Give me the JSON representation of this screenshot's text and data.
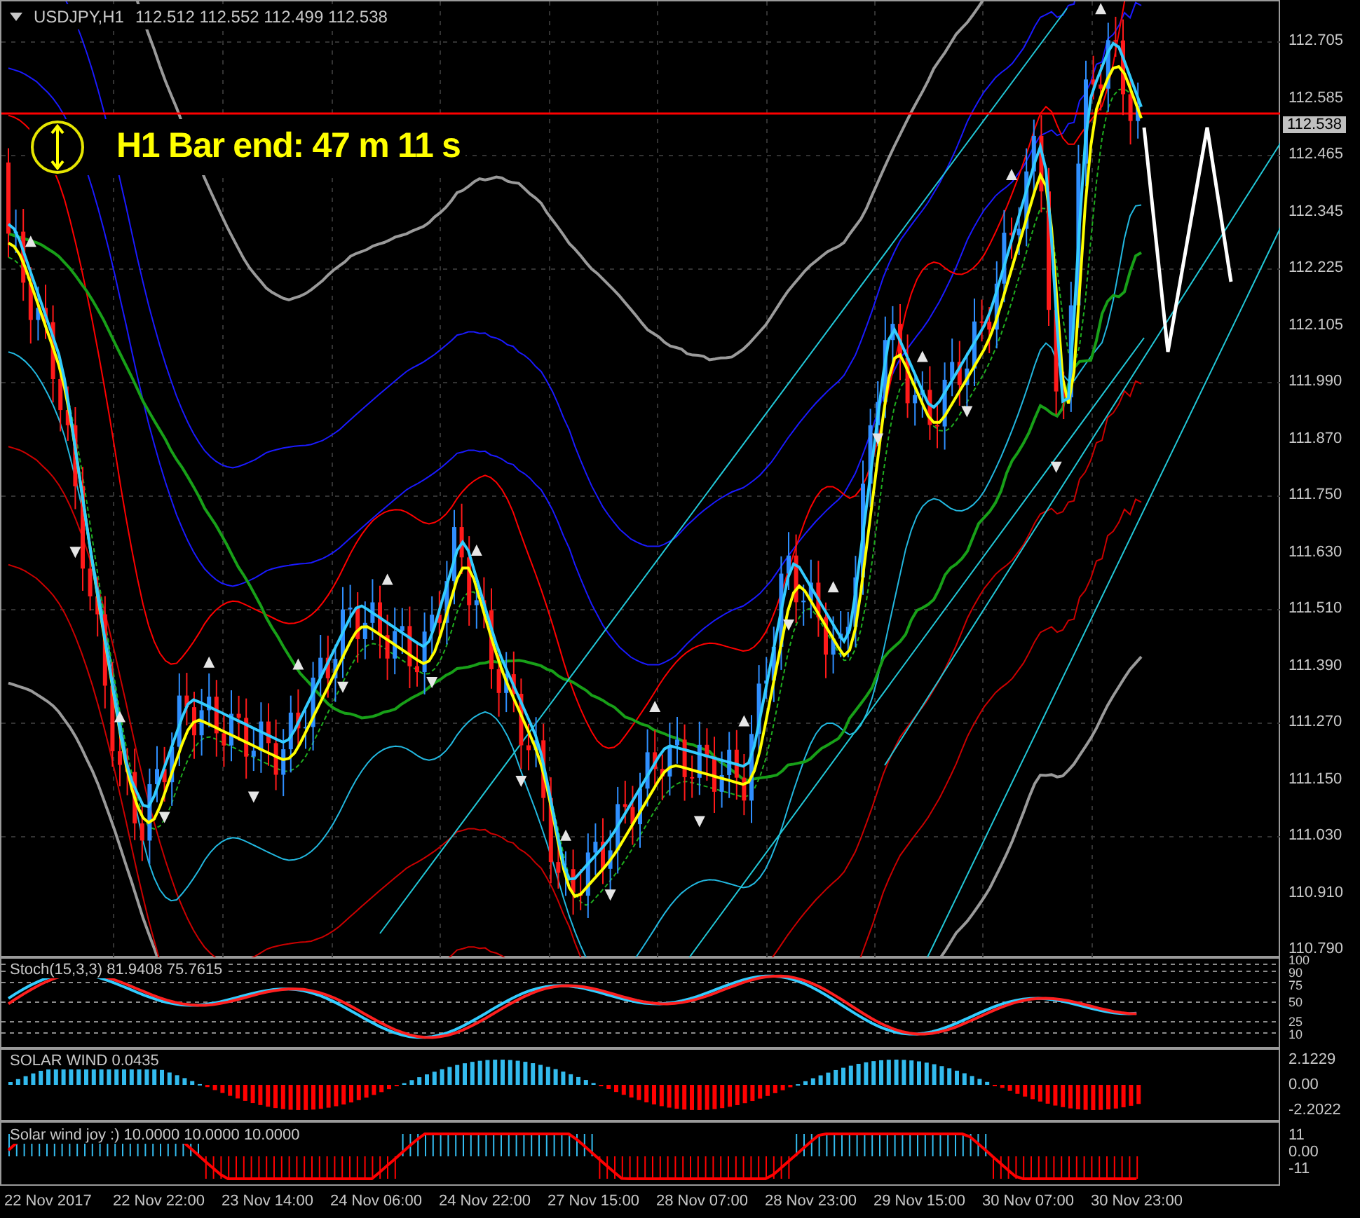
{
  "chart": {
    "symbol": "USDJPY,H1",
    "ohlc": "112.512 112.552 112.499 112.538",
    "timer": "H1 Bar end: 47 m 11 s",
    "current_price": "112.538",
    "price_ticks": [
      "112.705",
      "112.585",
      "112.465",
      "112.345",
      "112.225",
      "112.105",
      "111.990",
      "111.870",
      "111.750",
      "111.630",
      "111.510",
      "111.390",
      "111.270",
      "111.150",
      "111.030",
      "110.910",
      "110.790"
    ]
  },
  "stochastic": {
    "label": "Stoch(15,3,3) 81.9408 75.7615",
    "ticks": [
      "100",
      "90",
      "75",
      "50",
      "25",
      "10"
    ]
  },
  "solar_wind": {
    "label": "SOLAR WIND 0.0435",
    "ticks": [
      "2.1229",
      "0.00",
      "-2.2022"
    ]
  },
  "solar_wind_joy": {
    "label": "Solar wind joy :) 10.0000 10.0000 10.0000",
    "ticks": [
      "11",
      "0.00",
      "-11"
    ]
  },
  "time_axis": [
    "22 Nov 2017",
    "22 Nov 22:00",
    "23 Nov 14:00",
    "24 Nov 06:00",
    "24 Nov 22:00",
    "27 Nov 15:00",
    "28 Nov 07:00",
    "28 Nov 23:00",
    "29 Nov 15:00",
    "30 Nov 07:00",
    "30 Nov 23:00"
  ]
}
